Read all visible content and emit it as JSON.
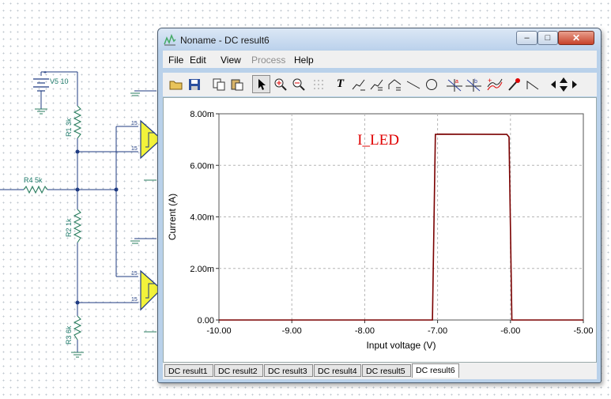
{
  "schematic": {
    "v5_label": "V5 10",
    "r1_label": "R1 3k",
    "r2_label": "R2 1k",
    "r3_label": "R3 6k",
    "r4_label": "R4 5k",
    "pin_top": "15",
    "pin_bottom": "15",
    "pin_top2": "15",
    "pin_bottom2": "15"
  },
  "window": {
    "title": "Noname - DC result6",
    "controls": {
      "minimize": "–",
      "maximize": "□",
      "close": "✕"
    }
  },
  "menu": {
    "file": "File",
    "edit": "Edit",
    "view": "View",
    "process": "Process",
    "help": "Help"
  },
  "toolbar": {
    "icons": [
      "open-folder-icon",
      "save-icon",
      "copy-icon",
      "paste-icon",
      "pointer-icon",
      "zoom-in-icon",
      "zoom-out-icon",
      "grid-icon",
      "text-icon",
      "cursor-a-icon",
      "cursor-b-icon",
      "cursor-c-icon",
      "line-icon",
      "circle-icon",
      "marker-a-icon",
      "marker-b-icon",
      "curve-add-icon",
      "pipette-icon",
      "step-icon",
      "arrow-left-icon",
      "arrow-updown-icon",
      "arrow-right-icon"
    ],
    "text_glyph": "T"
  },
  "chart_data": {
    "type": "line",
    "title": "",
    "annotation": "I_LED",
    "xlabel": "Input voltage (V)",
    "ylabel": "Current (A)",
    "xlim": [
      -10.0,
      -5.0
    ],
    "ylim": [
      0,
      0.008
    ],
    "x_ticks": [
      "-10.00",
      "-9.00",
      "-8.00",
      "-7.00",
      "-6.00",
      "-5.00"
    ],
    "x_tick_values": [
      -10,
      -9,
      -8,
      -7,
      -6,
      -5
    ],
    "y_ticks": [
      "0.00",
      "2.00m",
      "4.00m",
      "6.00m",
      "8.00m"
    ],
    "y_tick_values": [
      0,
      0.002,
      0.004,
      0.006,
      0.008
    ],
    "grid": true,
    "series": [
      {
        "color": "#7a0000",
        "x": [
          -10.0,
          -7.07,
          -7.03,
          -6.98,
          -6.05,
          -6.02,
          -5.98,
          -5.0
        ],
        "y": [
          0.0,
          0.0,
          0.0072,
          0.00721,
          0.0072,
          0.0071,
          0.0,
          0.0
        ]
      }
    ]
  },
  "tabs": [
    "DC result1",
    "DC result2",
    "DC result3",
    "DC result4",
    "DC result5",
    "DC result6"
  ],
  "active_tab": "DC result6",
  "colors": {
    "trace": "#7a0000",
    "annotation": "#e00000",
    "schematic_wire": "#1e3a8a",
    "opamp_fill": "#f2f23a"
  }
}
